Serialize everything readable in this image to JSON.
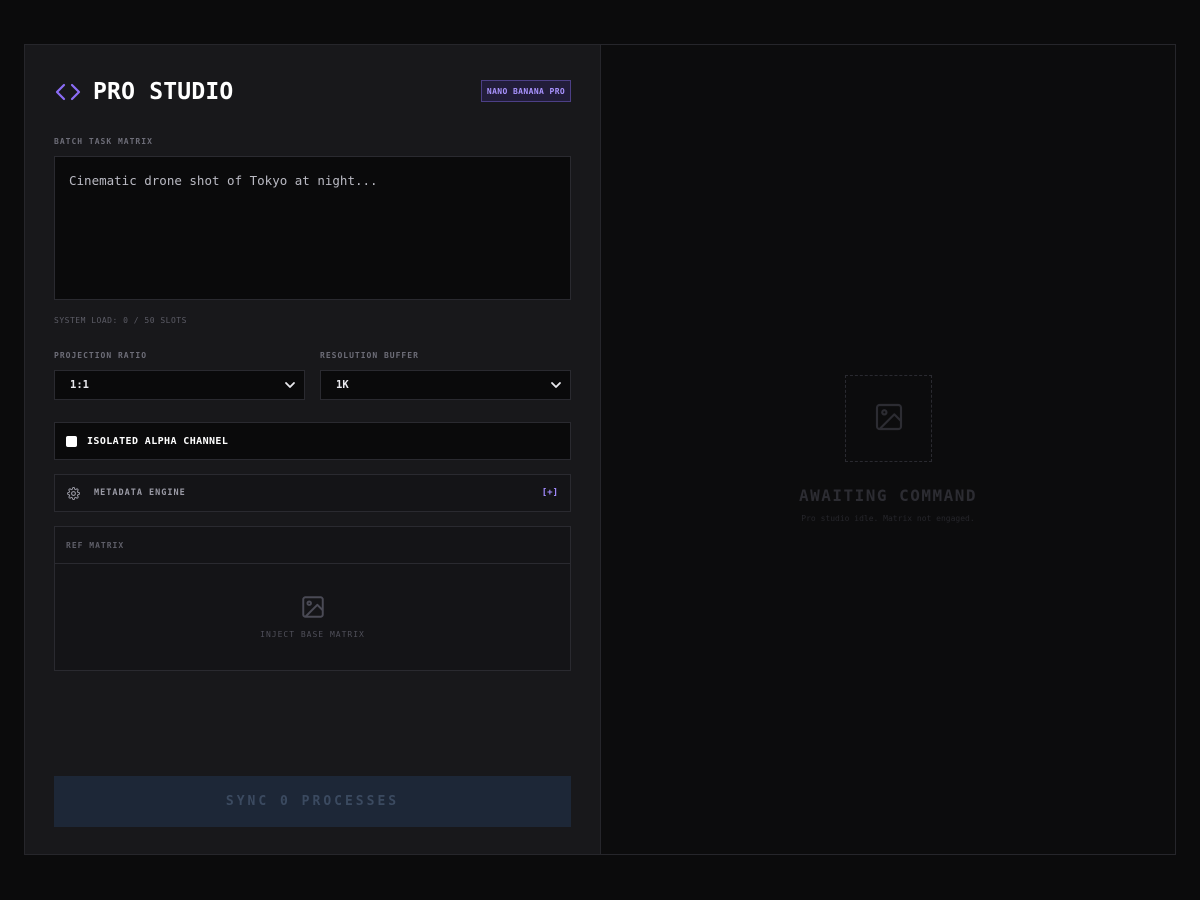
{
  "header": {
    "title": "PRO STUDIO",
    "badge": "NANO BANANA PRO",
    "accent_color": "#8b6cf6"
  },
  "batch": {
    "label": "BATCH TASK MATRIX",
    "prompt_text": "Cinematic drone shot of Tokyo at night...",
    "status": "SYSTEM LOAD: 0 / 50 SLOTS"
  },
  "projection": {
    "label": "PROJECTION RATIO",
    "value": "1:1"
  },
  "resolution": {
    "label": "RESOLUTION BUFFER",
    "value": "1K"
  },
  "alpha": {
    "label": "ISOLATED ALPHA CHANNEL",
    "checked": false
  },
  "metadata": {
    "label": "METADATA ENGINE",
    "toggle": "[+]"
  },
  "ref": {
    "label": "REF MATRIX",
    "drop_label": "INJECT BASE MATRIX"
  },
  "action": {
    "label": "SYNC 0 PROCESSES"
  },
  "preview": {
    "title": "AWAITING COMMAND",
    "subtitle": "Pro studio idle. Matrix not engaged."
  },
  "icons": {
    "brand": "code-icon",
    "select_chevron": "chevron-down-icon",
    "metadata": "gear-icon",
    "image": "image-icon"
  }
}
